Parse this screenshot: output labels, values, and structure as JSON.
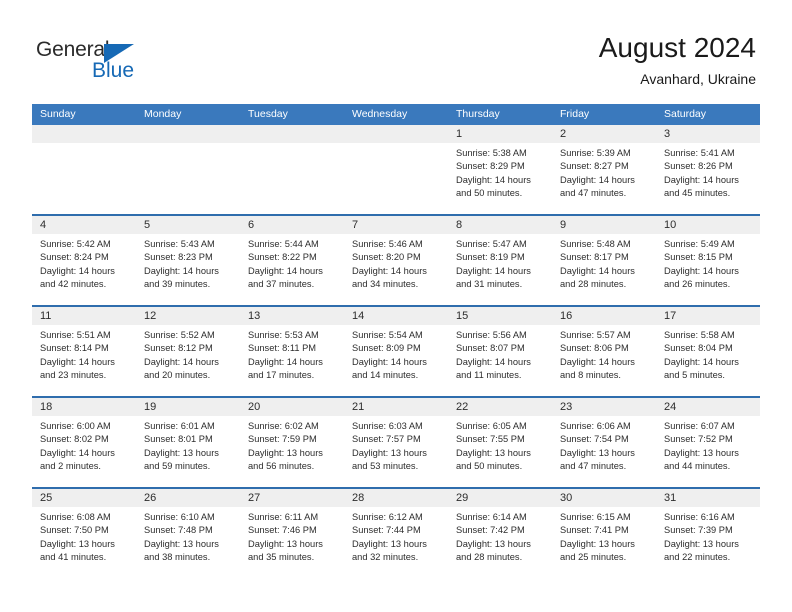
{
  "brand": {
    "name_part1": "General",
    "name_part2": "Blue",
    "triangle_icon": "triangle-icon",
    "color_dark": "#2b2b2b",
    "color_blue": "#1669b5"
  },
  "header": {
    "title": "August 2024",
    "subtitle": "Avanhard, Ukraine"
  },
  "colors": {
    "header_row_bg": "#3a79bd",
    "row_divider": "#2f6dad",
    "day_band_bg": "#efefef",
    "text": "#2d2d2d"
  },
  "weekdays": [
    "Sunday",
    "Monday",
    "Tuesday",
    "Wednesday",
    "Thursday",
    "Friday",
    "Saturday"
  ],
  "weeks": [
    [
      {
        "day": "",
        "empty": true
      },
      {
        "day": "",
        "empty": true
      },
      {
        "day": "",
        "empty": true
      },
      {
        "day": "",
        "empty": true
      },
      {
        "day": "1",
        "sunrise": "Sunrise: 5:38 AM",
        "sunset": "Sunset: 8:29 PM",
        "daylight": "Daylight: 14 hours and 50 minutes."
      },
      {
        "day": "2",
        "sunrise": "Sunrise: 5:39 AM",
        "sunset": "Sunset: 8:27 PM",
        "daylight": "Daylight: 14 hours and 47 minutes."
      },
      {
        "day": "3",
        "sunrise": "Sunrise: 5:41 AM",
        "sunset": "Sunset: 8:26 PM",
        "daylight": "Daylight: 14 hours and 45 minutes."
      }
    ],
    [
      {
        "day": "4",
        "sunrise": "Sunrise: 5:42 AM",
        "sunset": "Sunset: 8:24 PM",
        "daylight": "Daylight: 14 hours and 42 minutes."
      },
      {
        "day": "5",
        "sunrise": "Sunrise: 5:43 AM",
        "sunset": "Sunset: 8:23 PM",
        "daylight": "Daylight: 14 hours and 39 minutes."
      },
      {
        "day": "6",
        "sunrise": "Sunrise: 5:44 AM",
        "sunset": "Sunset: 8:22 PM",
        "daylight": "Daylight: 14 hours and 37 minutes."
      },
      {
        "day": "7",
        "sunrise": "Sunrise: 5:46 AM",
        "sunset": "Sunset: 8:20 PM",
        "daylight": "Daylight: 14 hours and 34 minutes."
      },
      {
        "day": "8",
        "sunrise": "Sunrise: 5:47 AM",
        "sunset": "Sunset: 8:19 PM",
        "daylight": "Daylight: 14 hours and 31 minutes."
      },
      {
        "day": "9",
        "sunrise": "Sunrise: 5:48 AM",
        "sunset": "Sunset: 8:17 PM",
        "daylight": "Daylight: 14 hours and 28 minutes."
      },
      {
        "day": "10",
        "sunrise": "Sunrise: 5:49 AM",
        "sunset": "Sunset: 8:15 PM",
        "daylight": "Daylight: 14 hours and 26 minutes."
      }
    ],
    [
      {
        "day": "11",
        "sunrise": "Sunrise: 5:51 AM",
        "sunset": "Sunset: 8:14 PM",
        "daylight": "Daylight: 14 hours and 23 minutes."
      },
      {
        "day": "12",
        "sunrise": "Sunrise: 5:52 AM",
        "sunset": "Sunset: 8:12 PM",
        "daylight": "Daylight: 14 hours and 20 minutes."
      },
      {
        "day": "13",
        "sunrise": "Sunrise: 5:53 AM",
        "sunset": "Sunset: 8:11 PM",
        "daylight": "Daylight: 14 hours and 17 minutes."
      },
      {
        "day": "14",
        "sunrise": "Sunrise: 5:54 AM",
        "sunset": "Sunset: 8:09 PM",
        "daylight": "Daylight: 14 hours and 14 minutes."
      },
      {
        "day": "15",
        "sunrise": "Sunrise: 5:56 AM",
        "sunset": "Sunset: 8:07 PM",
        "daylight": "Daylight: 14 hours and 11 minutes."
      },
      {
        "day": "16",
        "sunrise": "Sunrise: 5:57 AM",
        "sunset": "Sunset: 8:06 PM",
        "daylight": "Daylight: 14 hours and 8 minutes."
      },
      {
        "day": "17",
        "sunrise": "Sunrise: 5:58 AM",
        "sunset": "Sunset: 8:04 PM",
        "daylight": "Daylight: 14 hours and 5 minutes."
      }
    ],
    [
      {
        "day": "18",
        "sunrise": "Sunrise: 6:00 AM",
        "sunset": "Sunset: 8:02 PM",
        "daylight": "Daylight: 14 hours and 2 minutes."
      },
      {
        "day": "19",
        "sunrise": "Sunrise: 6:01 AM",
        "sunset": "Sunset: 8:01 PM",
        "daylight": "Daylight: 13 hours and 59 minutes."
      },
      {
        "day": "20",
        "sunrise": "Sunrise: 6:02 AM",
        "sunset": "Sunset: 7:59 PM",
        "daylight": "Daylight: 13 hours and 56 minutes."
      },
      {
        "day": "21",
        "sunrise": "Sunrise: 6:03 AM",
        "sunset": "Sunset: 7:57 PM",
        "daylight": "Daylight: 13 hours and 53 minutes."
      },
      {
        "day": "22",
        "sunrise": "Sunrise: 6:05 AM",
        "sunset": "Sunset: 7:55 PM",
        "daylight": "Daylight: 13 hours and 50 minutes."
      },
      {
        "day": "23",
        "sunrise": "Sunrise: 6:06 AM",
        "sunset": "Sunset: 7:54 PM",
        "daylight": "Daylight: 13 hours and 47 minutes."
      },
      {
        "day": "24",
        "sunrise": "Sunrise: 6:07 AM",
        "sunset": "Sunset: 7:52 PM",
        "daylight": "Daylight: 13 hours and 44 minutes."
      }
    ],
    [
      {
        "day": "25",
        "sunrise": "Sunrise: 6:08 AM",
        "sunset": "Sunset: 7:50 PM",
        "daylight": "Daylight: 13 hours and 41 minutes."
      },
      {
        "day": "26",
        "sunrise": "Sunrise: 6:10 AM",
        "sunset": "Sunset: 7:48 PM",
        "daylight": "Daylight: 13 hours and 38 minutes."
      },
      {
        "day": "27",
        "sunrise": "Sunrise: 6:11 AM",
        "sunset": "Sunset: 7:46 PM",
        "daylight": "Daylight: 13 hours and 35 minutes."
      },
      {
        "day": "28",
        "sunrise": "Sunrise: 6:12 AM",
        "sunset": "Sunset: 7:44 PM",
        "daylight": "Daylight: 13 hours and 32 minutes."
      },
      {
        "day": "29",
        "sunrise": "Sunrise: 6:14 AM",
        "sunset": "Sunset: 7:42 PM",
        "daylight": "Daylight: 13 hours and 28 minutes."
      },
      {
        "day": "30",
        "sunrise": "Sunrise: 6:15 AM",
        "sunset": "Sunset: 7:41 PM",
        "daylight": "Daylight: 13 hours and 25 minutes."
      },
      {
        "day": "31",
        "sunrise": "Sunrise: 6:16 AM",
        "sunset": "Sunset: 7:39 PM",
        "daylight": "Daylight: 13 hours and 22 minutes."
      }
    ]
  ]
}
